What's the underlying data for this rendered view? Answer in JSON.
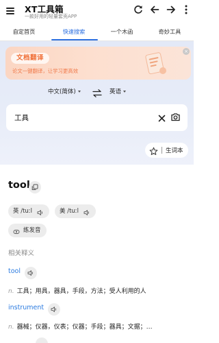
{
  "app": {
    "title": "XT工具箱",
    "subtitle": "一款好用的轻量套壳APP"
  },
  "tabs": [
    {
      "label": "自定首页",
      "active": false
    },
    {
      "label": "快速搜索",
      "active": true
    },
    {
      "label": "一个木函",
      "active": false
    },
    {
      "label": "奇妙工具",
      "active": false
    }
  ],
  "banner": {
    "title": "文档翻译",
    "desc": "论文一键翻译，让学习更高效",
    "close_glyph": "×"
  },
  "translate": {
    "source_lang": "中文(简体)",
    "target_lang": "英语"
  },
  "search": {
    "query": "工具"
  },
  "vocab": {
    "label": "生词本"
  },
  "result": {
    "word": "tool",
    "pron_uk": "英 /tuːl",
    "pron_us": "美 /tuːl",
    "practice_label": "练发音",
    "related_title": "相关释义",
    "definitions": [
      {
        "word": "tool",
        "pos": "n.",
        "meaning": "工具；用具，器具，手段，方法；受人利用的人"
      },
      {
        "word": "instrument",
        "pos": "n.",
        "meaning": "器械；仪器，仪表；仪器；手段；器具；文据；…"
      }
    ]
  },
  "colors": {
    "accent": "#2b6fe0",
    "banner_accent": "#f07038",
    "hero_bg": "#e5ebf8"
  }
}
